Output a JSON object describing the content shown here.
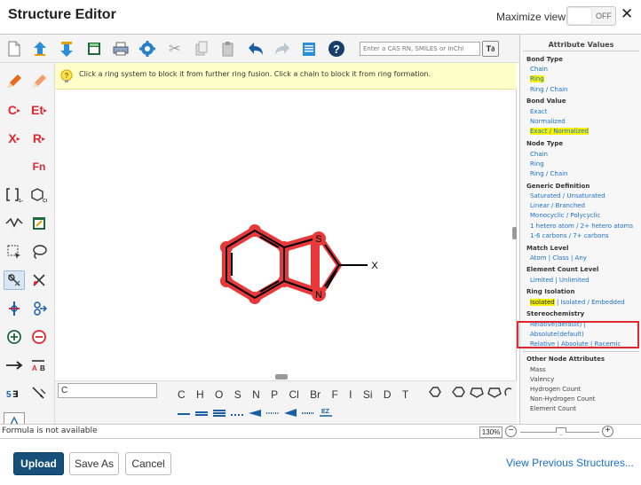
{
  "window": {
    "title": "Structure Editor",
    "maximize_label": "Maximize view",
    "toggle_state": "OFF"
  },
  "toolbar": {
    "search_placeholder": "Enter a CAS RN, SMILES or InChI",
    "search_button": "T",
    "icons": [
      "new-document-icon",
      "import-icon",
      "export-icon",
      "template-icon",
      "print-icon",
      "settings-icon",
      "cut-icon",
      "copy-icon",
      "paste-icon",
      "undo-icon",
      "redo-icon",
      "clipboard-icon",
      "help-icon"
    ]
  },
  "hint": {
    "text": "Click a ring system to block it from further ring fusion. Click a chain to block it from ring formation."
  },
  "left_tools": {
    "carbon": "C",
    "ethyl": "Et",
    "x_var": "X",
    "r_group": "R",
    "fn": "Fn"
  },
  "molecule": {
    "label_s": "S",
    "label_n": "N",
    "label_x": "X"
  },
  "atom_bar": {
    "input_value": "C",
    "atoms": [
      "C",
      "H",
      "O",
      "S",
      "N",
      "P",
      "Cl",
      "Br",
      "F",
      "I",
      "Si",
      "D",
      "T"
    ],
    "ez_label": "EZ"
  },
  "attributes": {
    "title": "Attribute Values",
    "bond_type": {
      "heading": "Bond Type",
      "items": [
        "Chain",
        "Ring",
        "Ring / Chain"
      ]
    },
    "bond_value": {
      "heading": "Bond Value",
      "items": [
        "Exact",
        "Normalized",
        "Exact / Normalized"
      ]
    },
    "node_type": {
      "heading": "Node Type",
      "items": [
        "Chain",
        "Ring",
        "Ring / Chain"
      ]
    },
    "generic_definition": {
      "heading": "Generic Definition",
      "items": [
        "Saturated / Unsaturated",
        "Linear / Branched",
        "Monocyclic / Polycyclic",
        "1 hetero atom / 2+ hetero atoms",
        "1-6 carbons / 7+ carbons"
      ]
    },
    "match_level": {
      "heading": "Match Level",
      "items": [
        "Atom | Class | Any"
      ]
    },
    "element_count_level": {
      "heading": "Element Count Level",
      "items": [
        "Limited | Unlimited"
      ]
    },
    "ring_isolation": {
      "heading": "Ring Isolation",
      "selected": "Isolated",
      "rest": " | Isolated / Embedded"
    },
    "stereochemistry": {
      "heading": "Stereochemistry",
      "items": [
        "Relative(default) |",
        "Absolute(default)",
        "Relative | Absolute | Racemic"
      ]
    },
    "other_node": {
      "heading": "Other Node Attributes",
      "items": [
        "Mass",
        "Valency",
        "Hydrogen Count",
        "Non-Hydrogen Count",
        "Element Count"
      ]
    }
  },
  "status": {
    "formula": "Formula is not available",
    "zoom": "130%"
  },
  "footer": {
    "upload": "Upload",
    "save_as": "Save As",
    "cancel": "Cancel",
    "view_previous": "View Previous Structures..."
  },
  "colors": {
    "primary": "#16507a",
    "link": "#1a6fd0",
    "highlight": "#f7f300",
    "selection": "#e0262f",
    "hint_bg": "#ffffc9"
  }
}
